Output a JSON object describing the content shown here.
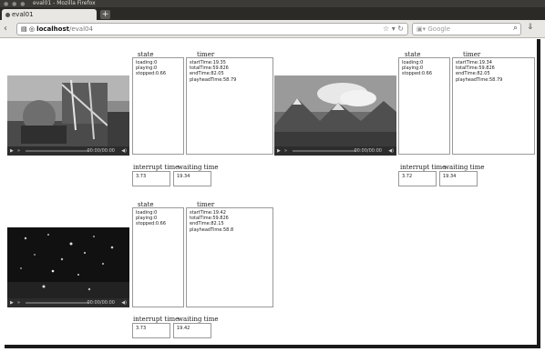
{
  "window": {
    "title": "eval01 - Mozilla Firefox"
  },
  "tabs": [
    {
      "label": "eval01"
    }
  ],
  "navbar": {
    "host": "localhost",
    "path": "/eval04",
    "search_placeholder": "Google"
  },
  "players": [
    {
      "id": "p1",
      "time_display": "00:00/00:00",
      "state_title": "state",
      "state_lines": [
        "loading:0",
        "playing:0",
        "stopped:0.66"
      ],
      "timer_title": "timer",
      "timer_lines": [
        "startTime:19.35",
        "totalTime:59.826",
        "endTime:82.05",
        "playheadTime:58.79"
      ],
      "interrupt_title": "interrupt time",
      "interrupt_value": "3.73",
      "waiting_title": "waiting time",
      "waiting_value": "19.34"
    },
    {
      "id": "p2",
      "time_display": "00:00/00:00",
      "state_title": "state",
      "state_lines": [
        "loading:0",
        "playing:0",
        "stopped:0.66"
      ],
      "timer_title": "timer",
      "timer_lines": [
        "startTime:19.34",
        "totalTime:59.826",
        "endTime:82.05",
        "playheadTime:58.79"
      ],
      "interrupt_title": "interrupt time",
      "interrupt_value": "3.72",
      "waiting_title": "waiting time",
      "waiting_value": "19.34"
    },
    {
      "id": "p3",
      "time_display": "00:00/00:00",
      "state_title": "state",
      "state_lines": [
        "loading:0",
        "playing:0",
        "stopped:0.66"
      ],
      "timer_title": "timer",
      "timer_lines": [
        "startTime:19.42",
        "totalTime:59.826",
        "endTime:82.15",
        "playheadTime:58.8"
      ],
      "interrupt_title": "interrupt time",
      "interrupt_value": "3.73",
      "waiting_title": "waiting time",
      "waiting_value": "19.42"
    }
  ]
}
